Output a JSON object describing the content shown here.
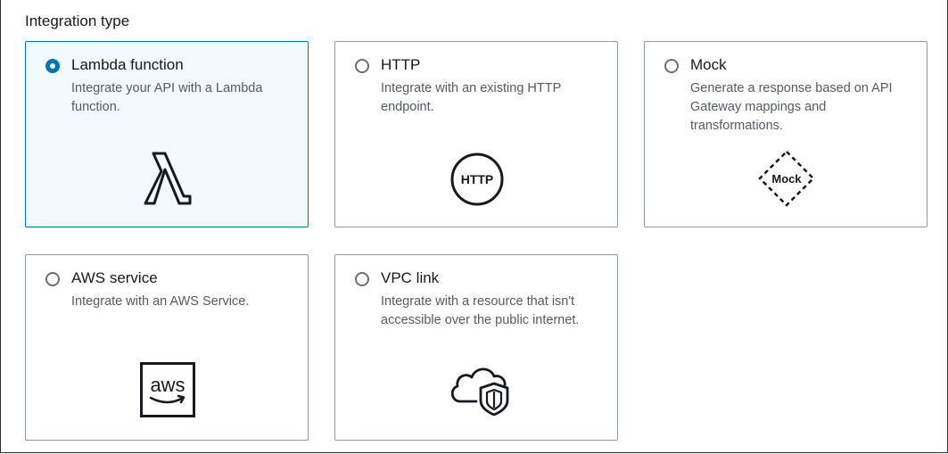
{
  "section": {
    "title": "Integration type"
  },
  "options": [
    {
      "title": "Lambda function",
      "description": "Integrate your API with a Lambda function.",
      "icon": "lambda-icon",
      "selected": true
    },
    {
      "title": "HTTP",
      "description": "Integrate with an existing HTTP endpoint.",
      "icon": "http-icon",
      "icon_text": "HTTP",
      "selected": false
    },
    {
      "title": "Mock",
      "description": "Generate a response based on API Gateway mappings and transformations.",
      "icon": "mock-icon",
      "icon_text": "Mock",
      "selected": false
    },
    {
      "title": "AWS service",
      "description": "Integrate with an AWS Service.",
      "icon": "aws-logo-icon",
      "icon_text": "aws",
      "selected": false
    },
    {
      "title": "VPC link",
      "description": "Integrate with a resource that isn't accessible over the public internet.",
      "icon": "cloud-shield-icon",
      "selected": false
    }
  ],
  "colors": {
    "accent": "#0073bb",
    "selected_background": "#f1faff",
    "card_border": "#8d99a8",
    "text_primary": "#16191f",
    "text_secondary": "#545b64"
  }
}
